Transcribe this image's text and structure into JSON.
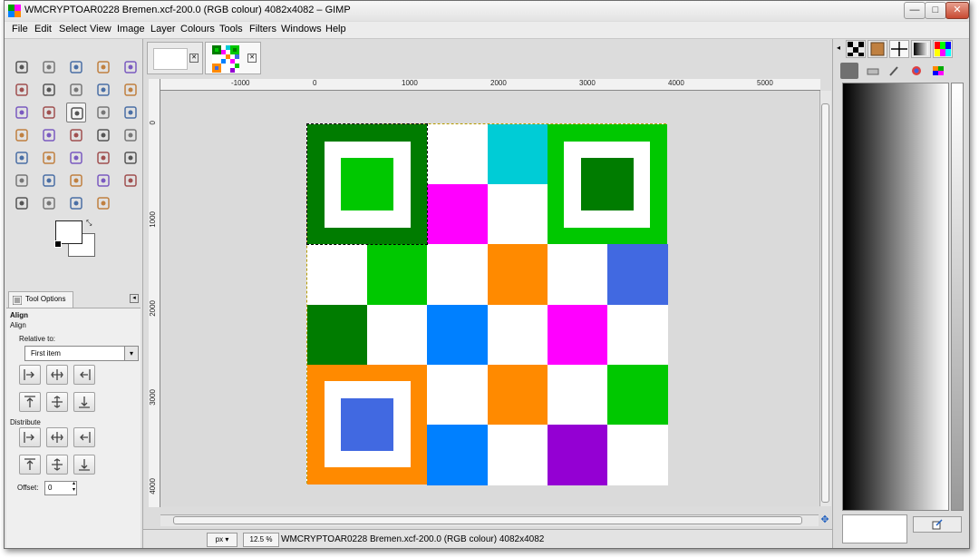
{
  "window": {
    "title": "WMCRYPTOAR0228 Bremen.xcf-200.0 (RGB colour) 4082x4082 – GIMP",
    "controls": {
      "minimize": "—",
      "maximize": "□",
      "close": "✕"
    }
  },
  "menu": [
    "File",
    "Edit",
    "Select",
    "View",
    "Image",
    "Layer",
    "Colours",
    "Tools",
    "Filters",
    "Windows",
    "Help"
  ],
  "toolbox": {
    "tools": [
      "rect-select",
      "ellipse-select",
      "free-select",
      "fuzzy-select",
      "by-color-select",
      "scissors-select",
      "foreground-select",
      "paths",
      "color-picker",
      "zoom",
      "measure",
      "move",
      "align",
      "crop",
      "rotate",
      "scale",
      "shear",
      "perspective",
      "flip",
      "cage-transform",
      "text",
      "bucket-fill",
      "blend",
      "pencil",
      "paintbrush",
      "eraser",
      "airbrush",
      "ink",
      "clone",
      "heal",
      "perspective-clone",
      "blur",
      "smudge",
      "dodge-burn"
    ],
    "active_tool": "align"
  },
  "tool_options": {
    "tab_label": "Tool Options",
    "title": "Align",
    "subtitle": "Align",
    "relative_to_label": "Relative to:",
    "relative_to_value": "First item",
    "distribute_label": "Distribute",
    "offset_label": "Offset:",
    "offset_value": "0"
  },
  "ruler": {
    "top_labels": [
      "-1000",
      "0",
      "1000",
      "2000",
      "3000",
      "4000",
      "5000"
    ],
    "left_labels": [
      "0",
      "1000",
      "2000",
      "3000",
      "4000"
    ]
  },
  "status": {
    "unit": "px",
    "zoom": "12.5 %",
    "text": "WMCRYPTOAR0228 Bremen.xcf-200.0 (RGB colour) 4082x4082"
  },
  "image": {
    "rows": 6,
    "cols": 6,
    "colors": {
      "white": "#ffffff",
      "dark_green": "#007c00",
      "green": "#00c800",
      "cyan": "#00ccd6",
      "magenta": "#ff00ff",
      "orange": "#ff8a00",
      "blue": "#4169e1",
      "azure": "#0080ff",
      "purple": "#9400d3"
    },
    "cells": [
      [
        "finder",
        "finder",
        "white",
        "cyan",
        "finder",
        "finder"
      ],
      [
        "finder",
        "finder",
        "magenta",
        "white",
        "finder",
        "finder"
      ],
      [
        "white",
        "green",
        "white",
        "orange",
        "white",
        "blue"
      ],
      [
        "dark_green",
        "white",
        "azure",
        "white",
        "magenta",
        "white"
      ],
      [
        "finder",
        "finder",
        "white",
        "orange",
        "white",
        "green"
      ],
      [
        "finder",
        "finder",
        "azure",
        "white",
        "purple",
        "white"
      ]
    ],
    "finders": [
      {
        "corner": "top-left",
        "outer": "#007c00",
        "ring": "#ffffff",
        "inner": "#00c800"
      },
      {
        "corner": "top-right",
        "outer": "#00c800",
        "ring": "#ffffff",
        "inner": "#007c00"
      },
      {
        "corner": "bottom-left",
        "outer": "#ff8a00",
        "ring": "#ffffff",
        "inner": "#4169e1"
      }
    ]
  }
}
